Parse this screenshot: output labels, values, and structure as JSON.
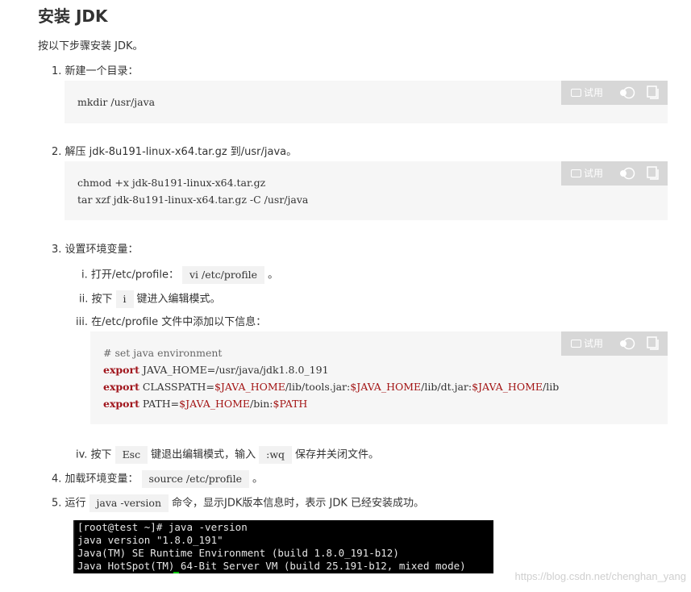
{
  "title": "安装 JDK",
  "intro": "按以下步骤安装 JDK。",
  "toolbar": {
    "try_label": "试用"
  },
  "steps": {
    "s1": "1. 新建一个目录：",
    "s2": "2. 解压 jdk-8u191-linux-x64.tar.gz 到/usr/java。",
    "s3": "3. 设置环境变量：",
    "s3i_pre": "i. 打开/etc/profile：",
    "s3i_code": "vi /etc/profile",
    "s3i_post": "。",
    "s3ii_pre": "ii. 按下",
    "s3ii_code": "i",
    "s3ii_post": "键进入编辑模式。",
    "s3iii": "iii. 在/etc/profile 文件中添加以下信息：",
    "s3iv_pre": "iv. 按下",
    "s3iv_code1": "Esc",
    "s3iv_mid": "键退出编辑模式，输入",
    "s3iv_code2": ":wq",
    "s3iv_post": "保存并关闭文件。",
    "s4_pre": "4. 加载环境变量：",
    "s4_code": "source /etc/profile",
    "s4_post": "。",
    "s5_pre": "5. 运行",
    "s5_code": "java -version",
    "s5_post": "命令，显示JDK版本信息时，表示 JDK 已经安装成功。"
  },
  "code1": {
    "line1": "mkdir /usr/java"
  },
  "code2": {
    "line1": "chmod +x jdk-8u191-linux-x64.tar.gz",
    "line2": "tar xzf jdk-8u191-linux-x64.tar.gz -C /usr/java"
  },
  "code3": {
    "comment": "# set java environment",
    "kw": "export",
    "l2_rest": " JAVA_HOME=/usr/java/jdk1.8.0_191",
    "l3_a": " CLASSPATH=",
    "l3_v1": "$JAVA_HOME",
    "l3_b": "/lib/tools.jar:",
    "l3_v2": "$JAVA_HOME",
    "l3_c": "/lib/dt.jar:",
    "l3_v3": "$JAVA_HOME",
    "l3_d": "/lib",
    "l4_a": " PATH=",
    "l4_v1": "$JAVA_HOME",
    "l4_b": "/bin:",
    "l4_v2": "$PATH"
  },
  "terminal": {
    "line1": "[root@test ~]# java -version",
    "line2": "java version \"1.8.0_191\"",
    "line3": "Java(TM) SE Runtime Environment (build 1.8.0_191-b12)",
    "line4": "Java HotSpot(TM) 64-Bit Server VM (build 25.191-b12, mixed mode)"
  },
  "watermark": "https://blog.csdn.net/chenghan_yang",
  "colors": {
    "toolbar_bg": "#d7d7d7",
    "code_bg": "#f6f6f6",
    "keyword": "#a0151c",
    "terminal_bg": "#000000"
  }
}
